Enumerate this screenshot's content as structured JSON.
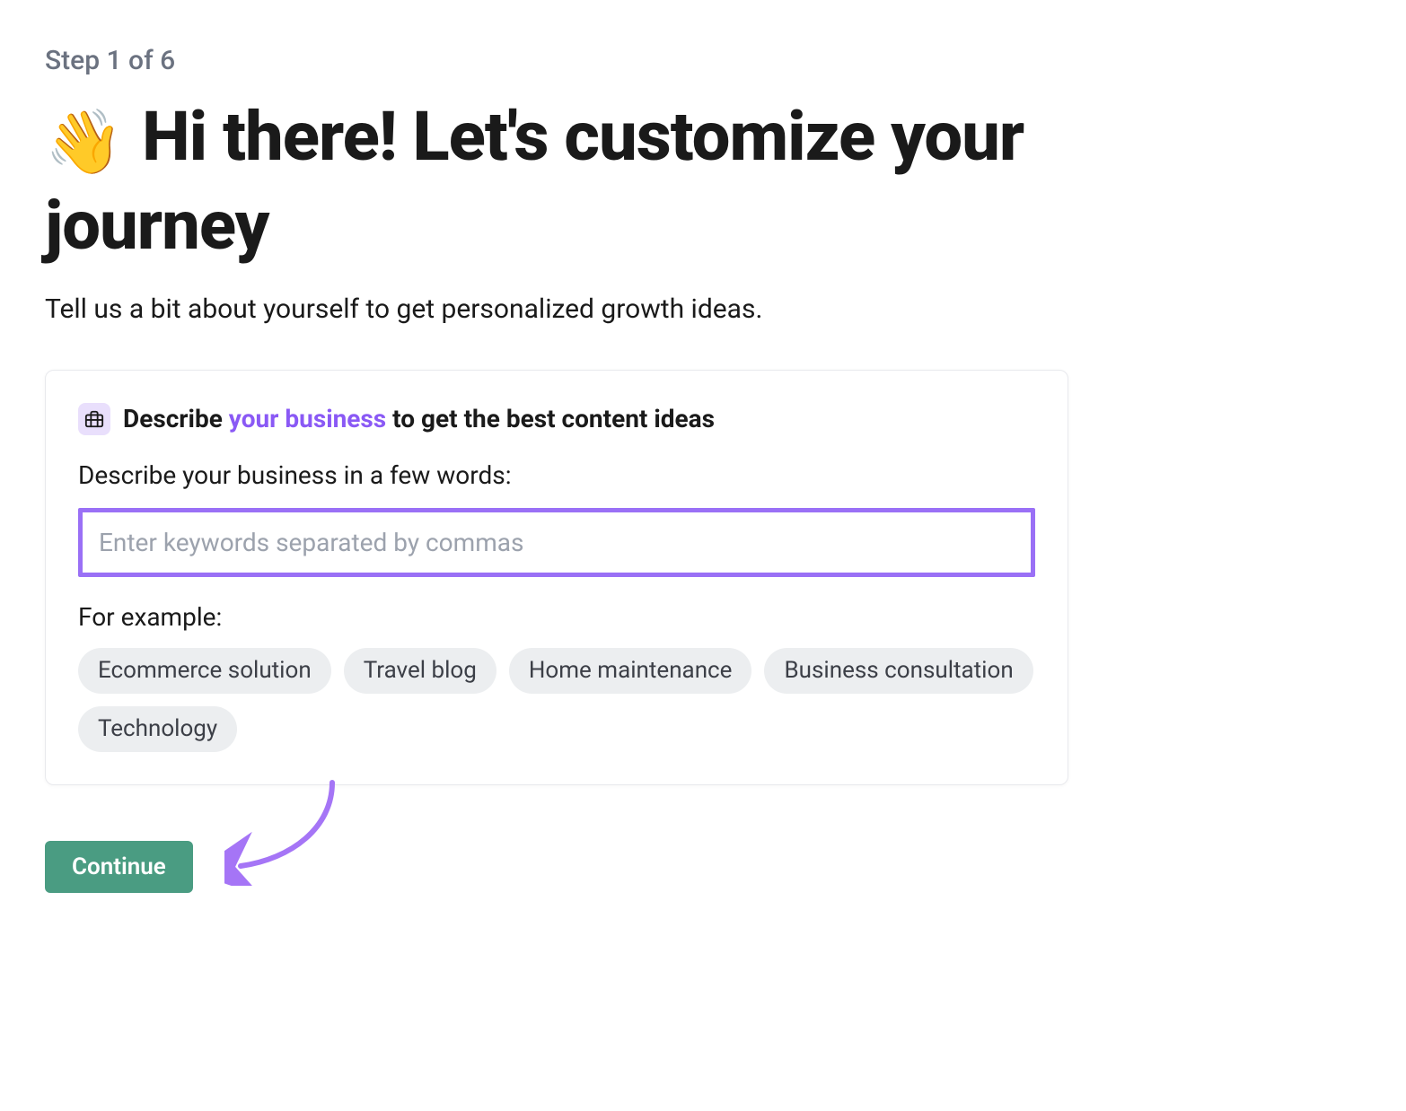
{
  "step_label": "Step 1 of 6",
  "heading_emoji": "👋",
  "heading_text": "Hi there! Let's customize your journey",
  "subheading": "Tell us a bit about yourself to get personalized growth ideas.",
  "card": {
    "title_before": "Describe ",
    "title_highlight": "your business",
    "title_after": " to get the best content ideas",
    "field_label": "Describe your business in a few words:",
    "input_placeholder": "Enter keywords separated by commas",
    "examples_label": "For example:",
    "example_chips": [
      "Ecommerce solution",
      "Travel blog",
      "Home maintenance",
      "Business consultation",
      "Technology"
    ]
  },
  "continue_label": "Continue"
}
